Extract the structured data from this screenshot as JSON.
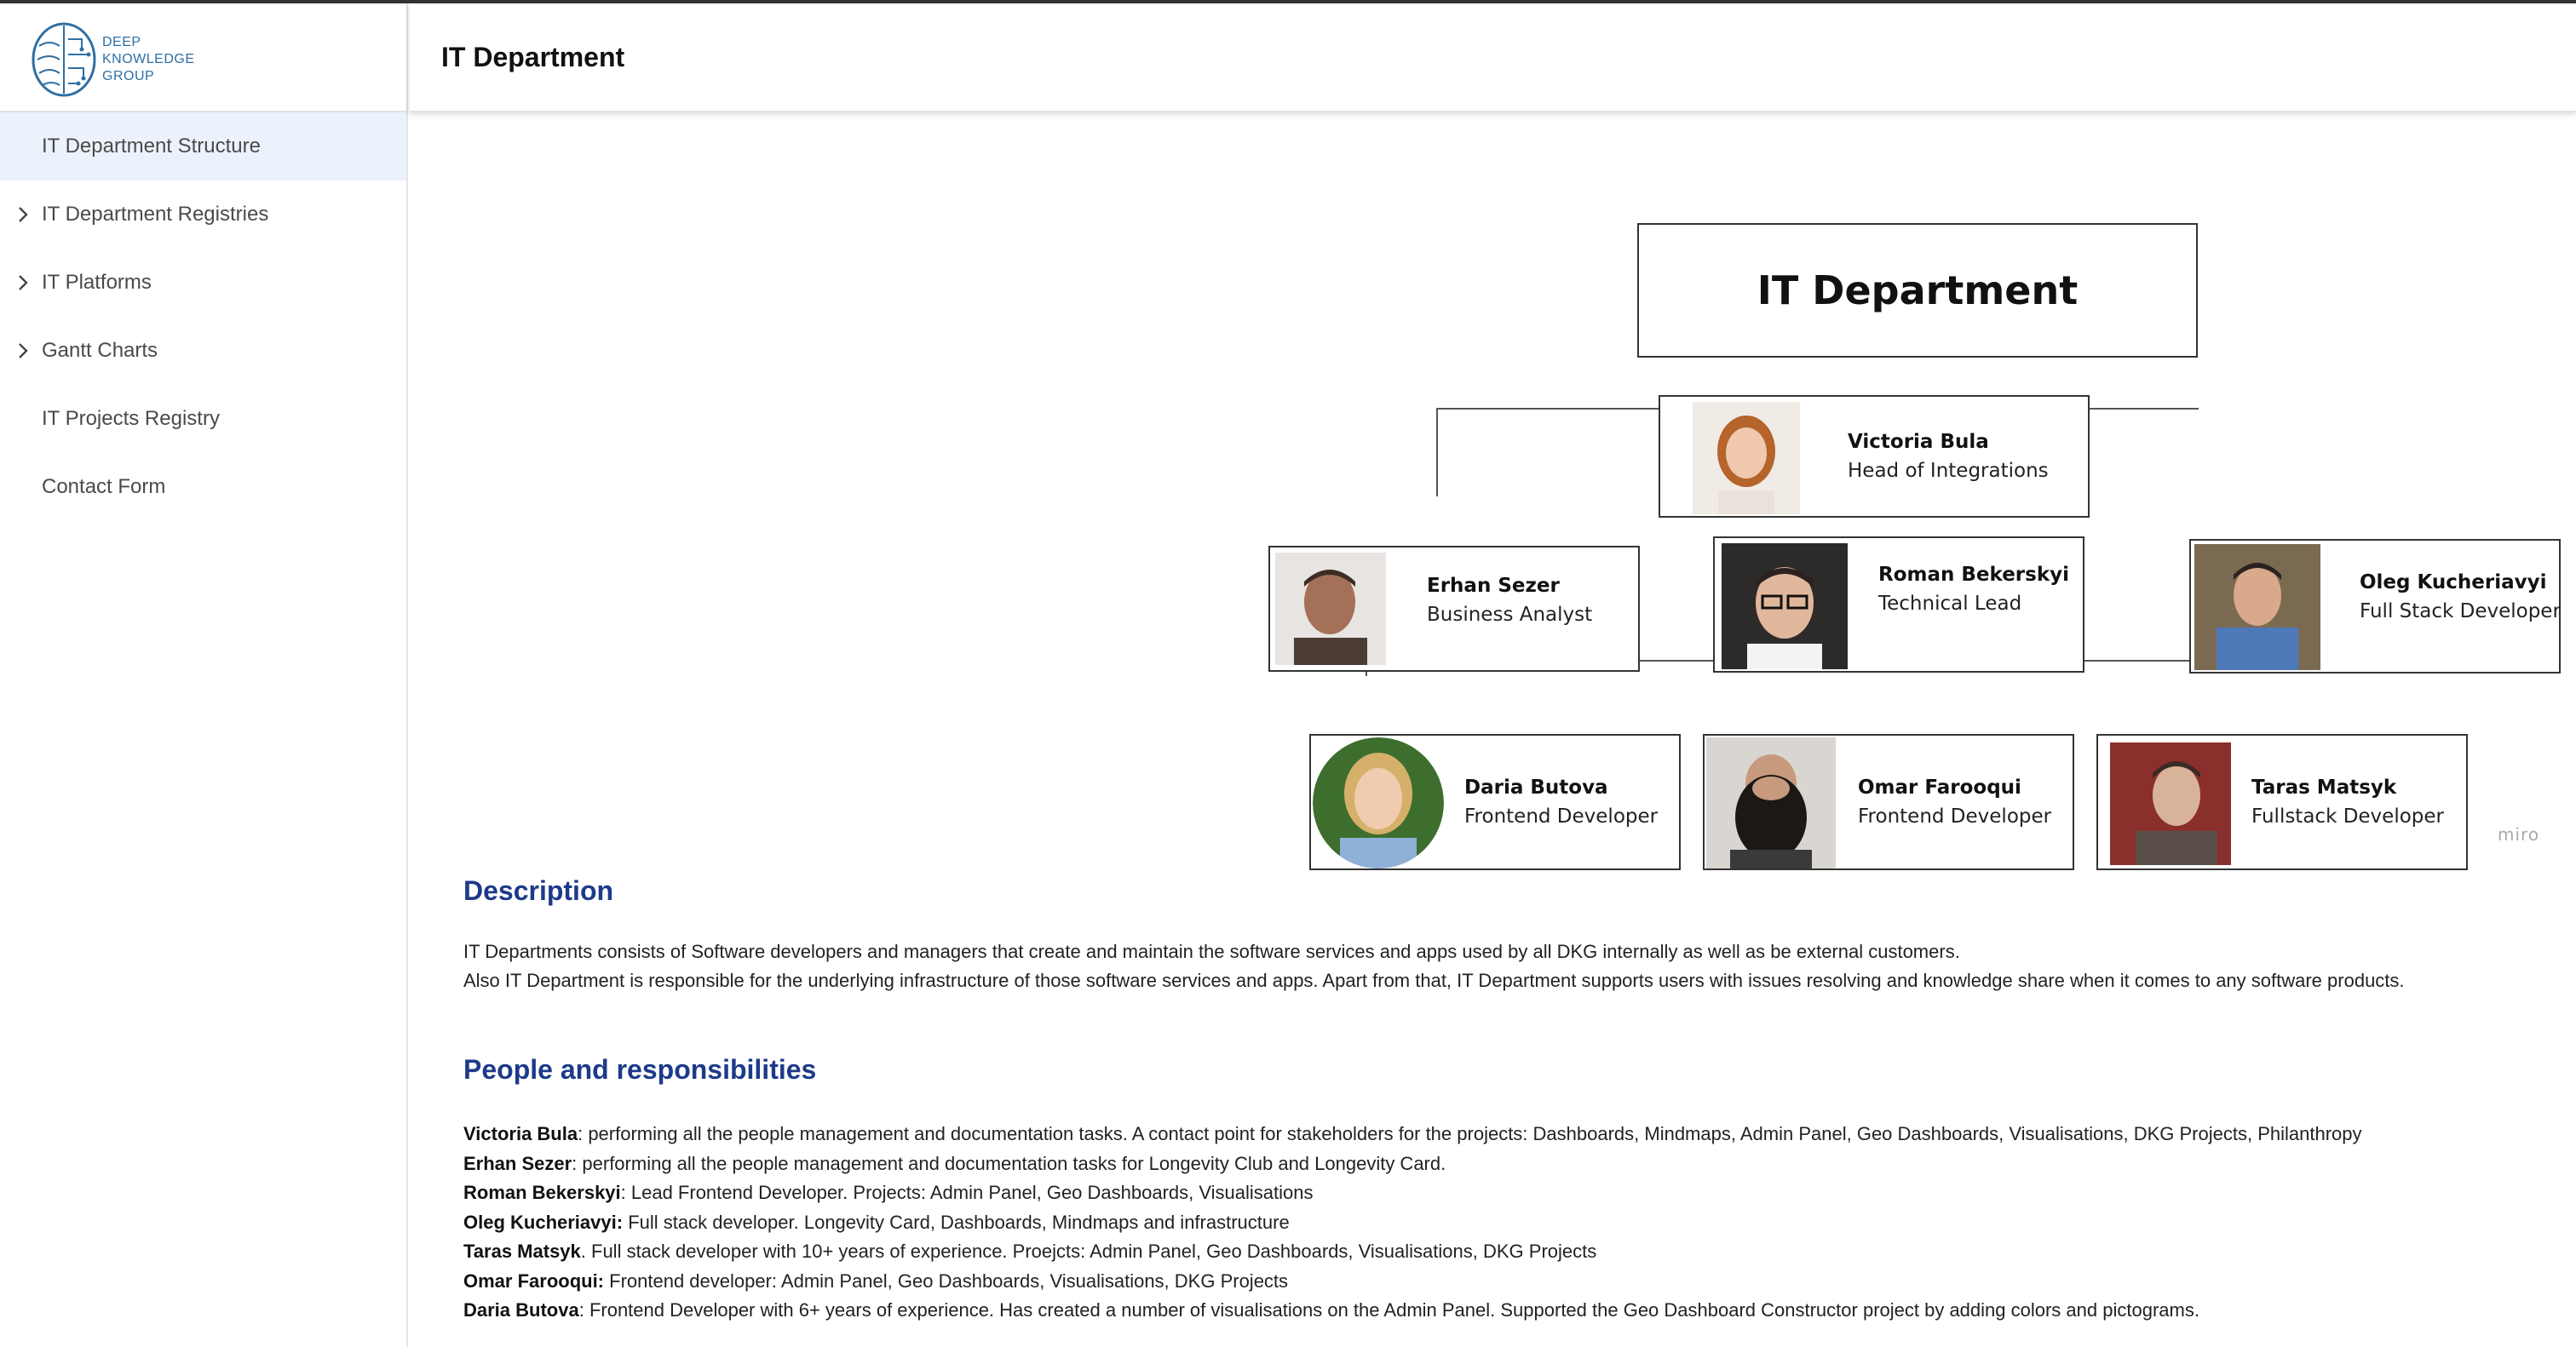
{
  "app": {
    "logo_lines": [
      "DEEP",
      "KNOWLEDGE",
      "GROUP"
    ],
    "header_title": "IT Department"
  },
  "sidebar": {
    "items": [
      {
        "label": "IT Department Structure",
        "active": true,
        "expandable": false
      },
      {
        "label": "IT Department Registries",
        "active": false,
        "expandable": true
      },
      {
        "label": "IT Platforms",
        "active": false,
        "expandable": true
      },
      {
        "label": "Gantt Charts",
        "active": false,
        "expandable": true
      },
      {
        "label": "IT Projects Registry",
        "active": false,
        "expandable": false
      },
      {
        "label": "Contact Form",
        "active": false,
        "expandable": false
      }
    ]
  },
  "org_chart": {
    "title": "IT Department",
    "watermark": "miro",
    "people": [
      {
        "name": "Victoria Bula",
        "role": "Head of Integrations"
      },
      {
        "name": "Erhan Sezer",
        "role": "Business Analyst"
      },
      {
        "name": "Roman Bekerskyi",
        "role": "Technical Lead"
      },
      {
        "name": "Oleg Kucheriavyi",
        "role": "Full Stack Developer"
      },
      {
        "name": "Daria Butova",
        "role": "Frontend Developer"
      },
      {
        "name": "Omar Farooqui",
        "role": "Frontend Developer"
      },
      {
        "name": "Taras Matsyk",
        "role": "Fullstack Developer"
      }
    ]
  },
  "description": {
    "title": "Description",
    "lines": [
      "IT Departments consists of Software developers and managers that create and maintain the software services and apps used by all DKG internally as well as be external customers.",
      "Also IT Department is responsible for the underlying infrastructure of those software services and apps. Apart from that, IT Department supports users with issues resolving and knowledge share when it comes to any software products."
    ]
  },
  "responsibilities": {
    "title": "People and responsibilities",
    "items": [
      {
        "name": "Victoria Bula",
        "text": ": performing all the people management and documentation tasks. A contact point for stakeholders for the projects: Dashboards, Mindmaps, Admin Panel, Geo Dashboards, Visualisations, DKG Projects, Philanthropy"
      },
      {
        "name": "Erhan Sezer",
        "text": ": performing all the people management and documentation tasks for Longevity Club and Longevity Card."
      },
      {
        "name": "Roman Bekerskyi",
        "text": ": Lead Frontend Developer. Projects: Admin Panel, Geo Dashboards, Visualisations"
      },
      {
        "name": "Oleg Kucheriavyi:",
        "text": " Full stack developer. Longevity Card, Dashboards, Mindmaps and infrastructure"
      },
      {
        "name": "Taras Matsyk",
        "text": ". Full stack developer with 10+ years of experience. Proejcts:  Admin Panel, Geo Dashboards, Visualisations, DKG Projects"
      },
      {
        "name": "Omar Farooqui:",
        "text": "  Frontend developer: Admin Panel, Geo Dashboards, Visualisations, DKG Projects"
      },
      {
        "name": "Daria Butova",
        "text": ": Frontend Developer with 6+ years of experience. Has created a number of visualisations on the Admin Panel. Supported the Geo Dashboard Constructor project by adding colors and pictograms."
      }
    ]
  }
}
